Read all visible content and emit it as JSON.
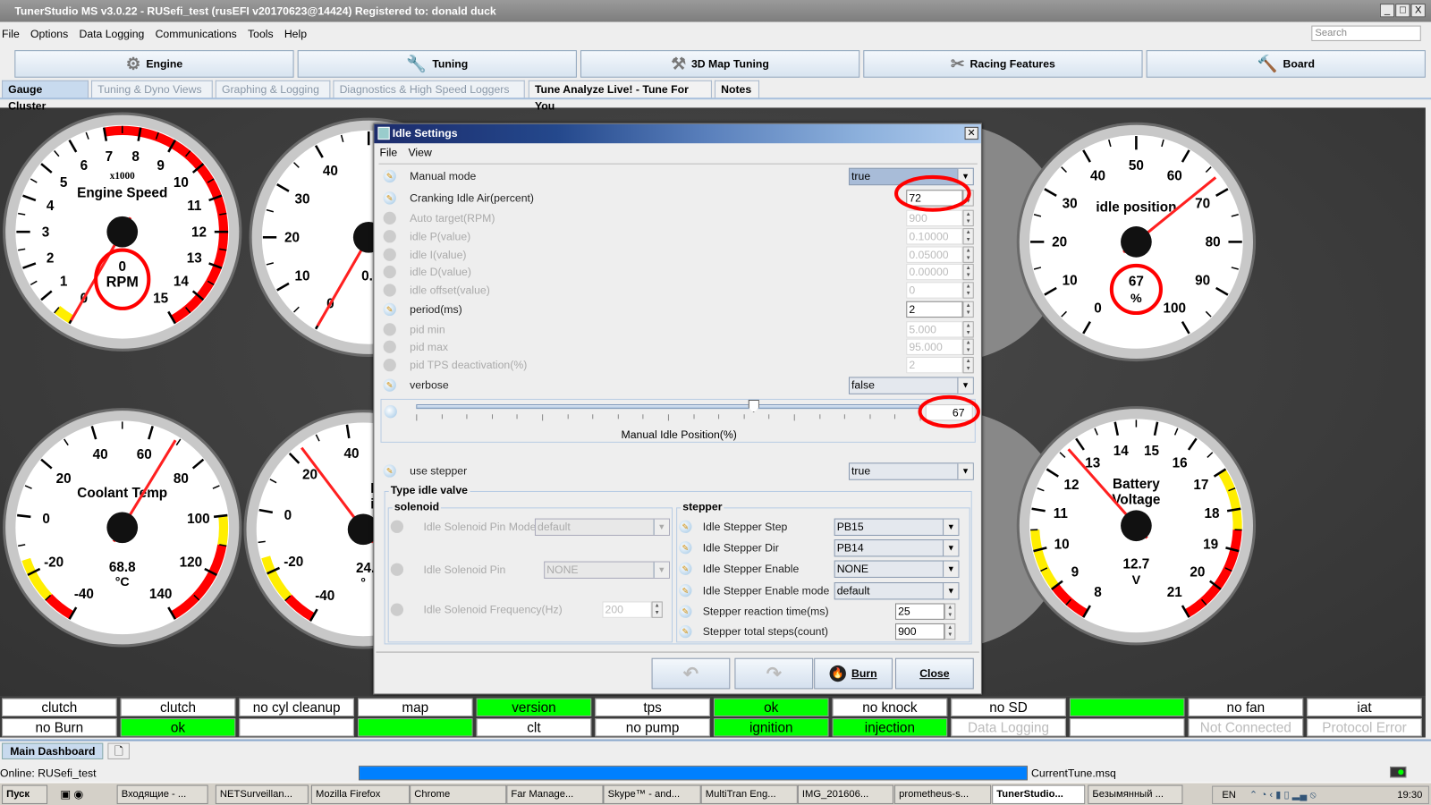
{
  "window": {
    "title": "TunerStudio MS v3.0.22 - RUSefi_test (rusEFI v20170623@14424) Registered to: donald duck",
    "controls": [
      "_",
      "□",
      "X"
    ]
  },
  "menu": [
    "File",
    "Options",
    "Data Logging",
    "Communications",
    "Tools",
    "Help"
  ],
  "search": {
    "placeholder": "Search"
  },
  "toolbar": [
    {
      "label": "Engine",
      "icon": "gear-icon"
    },
    {
      "label": "Tuning",
      "icon": "wrench-icon"
    },
    {
      "label": "3D Map Tuning",
      "icon": "tools-icon"
    },
    {
      "label": "Racing Features",
      "icon": "crossed-tools-icon"
    },
    {
      "label": "Board",
      "icon": "hammer-icon"
    }
  ],
  "tabs": [
    {
      "label": "Gauge Cluster",
      "selected": true
    },
    {
      "label": "Tuning & Dyno Views"
    },
    {
      "label": "Graphing & Logging"
    },
    {
      "label": "Diagnostics & High Speed Loggers"
    },
    {
      "label": "Tune Analyze Live! - Tune For You"
    },
    {
      "label": "Notes"
    }
  ],
  "gauges": [
    {
      "id": "engine-speed",
      "title": [
        "Engine Speed"
      ],
      "subtitle": "x1000",
      "value": "0",
      "unit": "RPM",
      "needle": 0,
      "min": 0,
      "max": 15,
      "labels": [
        "0",
        "1",
        "2",
        "3",
        "4",
        "5",
        "6",
        "7",
        "8",
        "9",
        "10",
        "11",
        "12",
        "13",
        "14",
        "15"
      ],
      "bands": [
        {
          "from": 0,
          "to": 0.5,
          "color": "#ffee00"
        },
        {
          "from": 7,
          "to": 13.5,
          "color": "#ff0000"
        },
        {
          "from": 13.5,
          "to": 15,
          "color": "#ff0000"
        }
      ]
    },
    {
      "id": "throttle-position",
      "title": [
        "Thr",
        "Pos"
      ],
      "value": "0.",
      "unit": "",
      "needle": 0,
      "min": 0,
      "max": 100,
      "labels": [
        "0",
        "10",
        "20",
        "30",
        "40"
      ],
      "bands": []
    },
    {
      "id": "idle-position",
      "title": [
        "idle position"
      ],
      "value": "67",
      "unit": "%",
      "needle": 67,
      "min": 0,
      "max": 100,
      "labels": [
        "0",
        "10",
        "20",
        "30",
        "40",
        "50",
        "60",
        "70",
        "80",
        "90",
        "100"
      ],
      "bands": []
    },
    {
      "id": "coolant-temp",
      "title": [
        "Coolant Temp"
      ],
      "value": "68.8",
      "unit": "°C",
      "needle": 68.8,
      "min": -40,
      "max": 140,
      "labels": [
        "-40",
        "-20",
        "0",
        "20",
        "40",
        "60",
        "80",
        "100",
        "120",
        "140"
      ],
      "bands": [
        {
          "from": -40,
          "to": -30,
          "color": "#ff0000"
        },
        {
          "from": -30,
          "to": -15,
          "color": "#ffee00"
        },
        {
          "from": 100,
          "to": 110,
          "color": "#ffee00"
        },
        {
          "from": 110,
          "to": 140,
          "color": "#ff0000"
        }
      ]
    },
    {
      "id": "intake-air-temp",
      "title": [
        "Inta",
        "ir T"
      ],
      "value": "24.",
      "unit": "°",
      "needle": 24,
      "min": -40,
      "max": 130,
      "labels": [
        "-40",
        "-20",
        "0",
        "20",
        "40"
      ],
      "bands": [
        {
          "from": -40,
          "to": -30,
          "color": "#ff0000"
        },
        {
          "from": -30,
          "to": -15,
          "color": "#ffee00"
        }
      ]
    },
    {
      "id": "battery-voltage",
      "title": [
        "Battery",
        "Voltage"
      ],
      "value": "12.7",
      "unit": "V",
      "needle": 12.7,
      "min": 8,
      "max": 21,
      "labels": [
        "8",
        "9",
        "10",
        "11",
        "12",
        "13",
        "14",
        "15",
        "16",
        "17",
        "18",
        "19",
        "20",
        "21"
      ],
      "bands": [
        {
          "from": 8,
          "to": 9,
          "color": "#ff0000"
        },
        {
          "from": 9,
          "to": 10.5,
          "color": "#ffee00"
        },
        {
          "from": 17,
          "to": 18.5,
          "color": "#ffee00"
        },
        {
          "from": 18.5,
          "to": 21,
          "color": "#ff0000"
        }
      ]
    }
  ],
  "indicators": [
    [
      {
        "t": "clutch"
      },
      {
        "t": "clutch"
      },
      {
        "t": "no cyl cleanup"
      },
      {
        "t": "map"
      },
      {
        "t": "version",
        "s": "green"
      },
      {
        "t": "tps"
      },
      {
        "t": "ok",
        "s": "green"
      },
      {
        "t": "no knock"
      },
      {
        "t": "no SD"
      },
      {
        "t": "",
        "s": "green"
      },
      {
        "t": "no fan"
      },
      {
        "t": "iat"
      }
    ],
    [
      {
        "t": "no Burn"
      },
      {
        "t": "ok",
        "s": "green"
      },
      {
        "t": ""
      },
      {
        "t": "",
        "s": "green"
      },
      {
        "t": "clt"
      },
      {
        "t": "no pump"
      },
      {
        "t": "ignition",
        "s": "green"
      },
      {
        "t": "injection",
        "s": "green"
      },
      {
        "t": "Data Logging",
        "s": "dim"
      },
      {
        "t": ""
      },
      {
        "t": "Not Connected",
        "s": "dim"
      },
      {
        "t": "Protocol Error",
        "s": "dim"
      }
    ]
  ],
  "dialog": {
    "title": "Idle Settings",
    "menu": [
      "File",
      "View"
    ],
    "rows": [
      {
        "label": "Manual mode",
        "type": "combo",
        "value": "true",
        "enabled": true,
        "selected": true
      },
      {
        "label": "Cranking Idle Air(percent)",
        "type": "spin",
        "value": "72",
        "enabled": true
      },
      {
        "label": "Auto target(RPM)",
        "type": "spin",
        "value": "900",
        "enabled": false
      },
      {
        "label": "idle P(value)",
        "type": "spin",
        "value": "0.10000",
        "enabled": false
      },
      {
        "label": "idle I(value)",
        "type": "spin",
        "value": "0.05000",
        "enabled": false
      },
      {
        "label": "idle D(value)",
        "type": "spin",
        "value": "0.00000",
        "enabled": false
      },
      {
        "label": "idle offset(value)",
        "type": "spin",
        "value": "0",
        "enabled": false
      },
      {
        "label": "period(ms)",
        "type": "spin",
        "value": "2",
        "enabled": true
      },
      {
        "label": "pid min",
        "type": "spin",
        "value": "5.000",
        "enabled": false
      },
      {
        "label": "pid max",
        "type": "spin",
        "value": "95.000",
        "enabled": false
      },
      {
        "label": "pid TPS deactivation(%)",
        "type": "spin",
        "value": "2",
        "enabled": false
      },
      {
        "label": "verbose",
        "type": "combo",
        "value": "false",
        "enabled": true
      }
    ],
    "slider": {
      "label": "Manual Idle Position(%)",
      "value": "67",
      "percent": 67
    },
    "use_stepper": {
      "label": "use stepper",
      "value": "true"
    },
    "type_group": "Type idle valve",
    "solenoid": {
      "legend": "solenoid",
      "rows": [
        {
          "label": "Idle Solenoid Pin Mode",
          "type": "combo",
          "value": "default"
        },
        {
          "label": "Idle Solenoid Pin",
          "type": "combo",
          "value": "NONE"
        },
        {
          "label": "Idle Solenoid Frequency(Hz)",
          "type": "spin",
          "value": "200"
        }
      ]
    },
    "stepper": {
      "legend": "stepper",
      "rows": [
        {
          "label": "Idle Stepper Step",
          "type": "combo",
          "value": "PB15"
        },
        {
          "label": "Idle Stepper Dir",
          "type": "combo",
          "value": "PB14"
        },
        {
          "label": "Idle Stepper Enable",
          "type": "combo",
          "value": "NONE"
        },
        {
          "label": "Idle Stepper Enable mode",
          "type": "combo",
          "value": "default"
        },
        {
          "label": "Stepper reaction time(ms)",
          "type": "spin",
          "value": "25"
        },
        {
          "label": "Stepper total steps(count)",
          "type": "spin",
          "value": "900"
        }
      ]
    },
    "buttons": {
      "burn": "Burn",
      "close": "Close"
    }
  },
  "dashboard_tab": "Main Dashboard",
  "status": {
    "online": "Online: RUSefi_test",
    "progress": 100,
    "file": "CurrentTune.msq"
  },
  "taskbar": {
    "start": "Пуск",
    "items": [
      "Входящие - ...",
      "NETSurveillan...",
      "Mozilla Firefox",
      "Chrome",
      "Far Manage...",
      "Skype™ - and...",
      "MultiTran Eng...",
      "IMG_201606...",
      "prometheus-s...",
      "TunerStudio...",
      "Безымянный ..."
    ],
    "active": 9,
    "lang": "EN",
    "time": "19:30"
  },
  "colors": {
    "indicator_on": "#00ff00",
    "annotation": "#ff0000",
    "progress": "#0080ff"
  }
}
